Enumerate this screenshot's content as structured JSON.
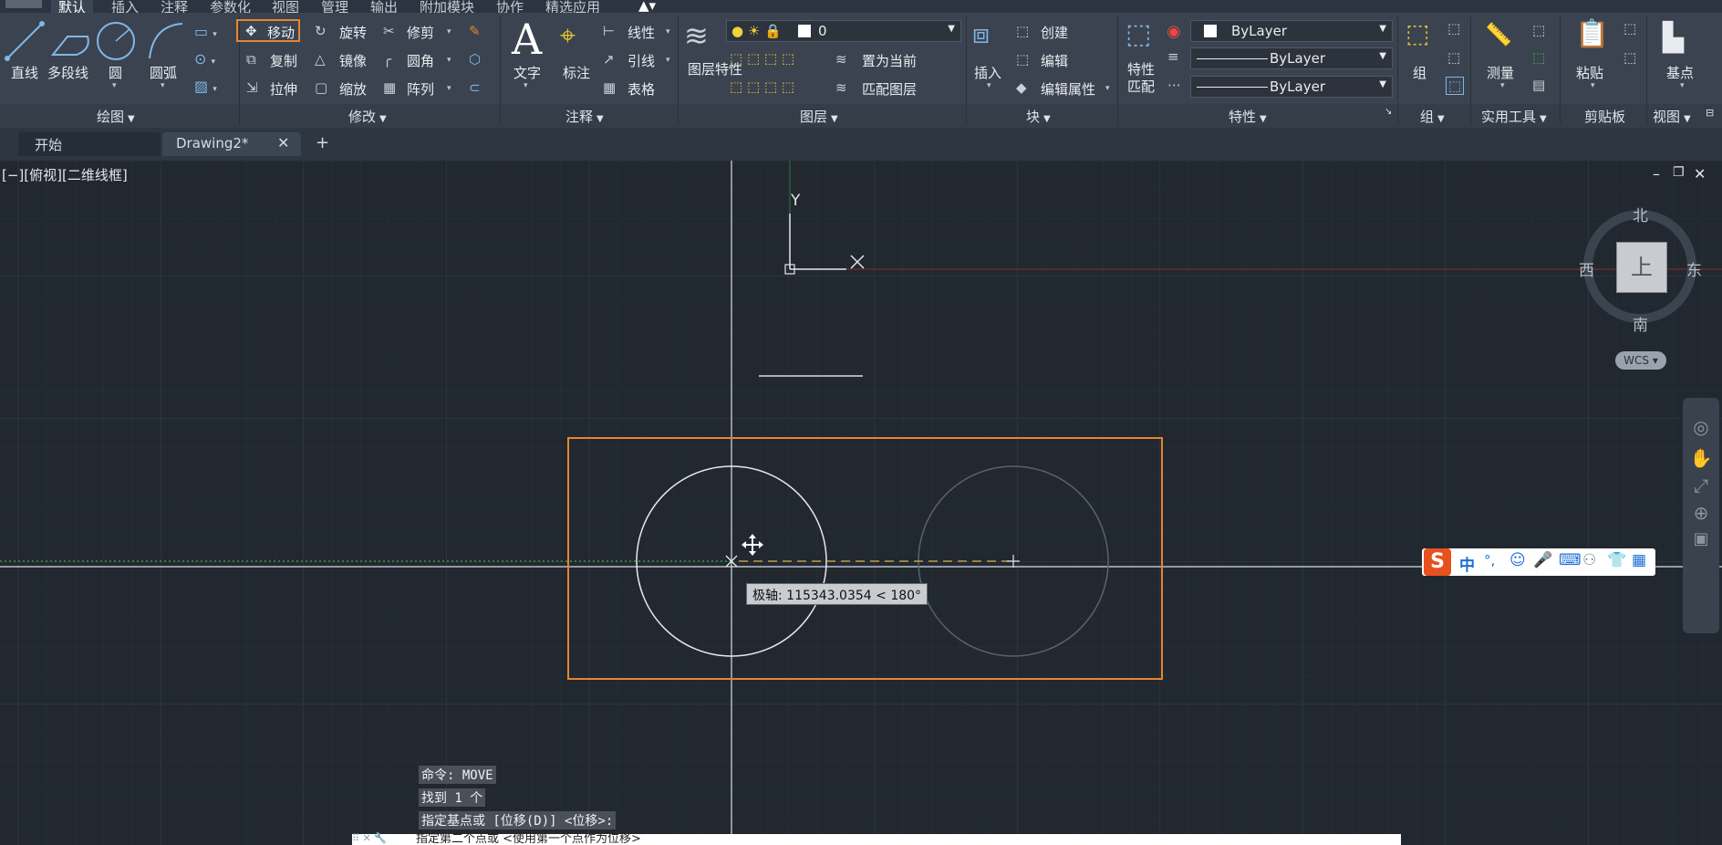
{
  "tabs": [
    "默认",
    "插入",
    "注释",
    "参数化",
    "视图",
    "管理",
    "输出",
    "附加模块",
    "协作",
    "精选应用"
  ],
  "ribbon": {
    "draw": {
      "line": "直线",
      "polyline": "多段线",
      "circle": "圆",
      "arc": "圆弧",
      "title": "绘图"
    },
    "modify": {
      "move": "移动",
      "rotate": "旋转",
      "trim": "修剪",
      "copy": "复制",
      "mirror": "镜像",
      "fillet": "圆角",
      "stretch": "拉伸",
      "scale": "缩放",
      "array": "阵列",
      "title": "修改"
    },
    "annotation": {
      "text": "文字",
      "dimension": "标注",
      "linear": "线性",
      "leader": "引线",
      "table": "表格",
      "title": "注释"
    },
    "layers": {
      "layer_props": "图层特性",
      "current_layer": "0",
      "set_current": "置为当前",
      "match_layer": "匹配图层",
      "title": "图层"
    },
    "block": {
      "insert": "插入",
      "create": "创建",
      "edit": "编辑",
      "edit_attr": "编辑属性",
      "title": "块"
    },
    "properties": {
      "match": "特性匹配",
      "color": "ByLayer",
      "linetype": "ByLayer",
      "lineweight": "ByLayer",
      "title": "特性"
    },
    "groups": {
      "group": "组",
      "title": "组"
    },
    "utilities": {
      "measure": "测量",
      "title": "实用工具"
    },
    "clipboard": {
      "paste": "粘贴",
      "title": "剪贴板"
    },
    "view": {
      "base": "基点",
      "title": "视图"
    }
  },
  "doc_tabs": {
    "start": "开始",
    "drawing": "Drawing2*",
    "close": "✕",
    "add": "+"
  },
  "viewport": {
    "label": "[−][俯视][二维线框]",
    "ucs_y": "Y",
    "viewcube": {
      "n": "北",
      "s": "南",
      "e": "东",
      "w": "西",
      "top": "上",
      "wcs": "WCS"
    },
    "tooltip": "极轴: 115343.0354 < 180°"
  },
  "command_history": [
    "命令:  MOVE",
    "找到 1 个",
    "指定基点或 [位移(D)] <位移>:"
  ],
  "command_prompt": "指定第二个点或 <使用第一个点作为位移>",
  "ime": {
    "lang": "中",
    "punct": "°,"
  },
  "colors": {
    "selection": "#e4862f",
    "crosshair": "#d9dde2",
    "axis_red": "#8a2b2b",
    "axis_green": "#2b8a3b",
    "background": "#212830"
  }
}
